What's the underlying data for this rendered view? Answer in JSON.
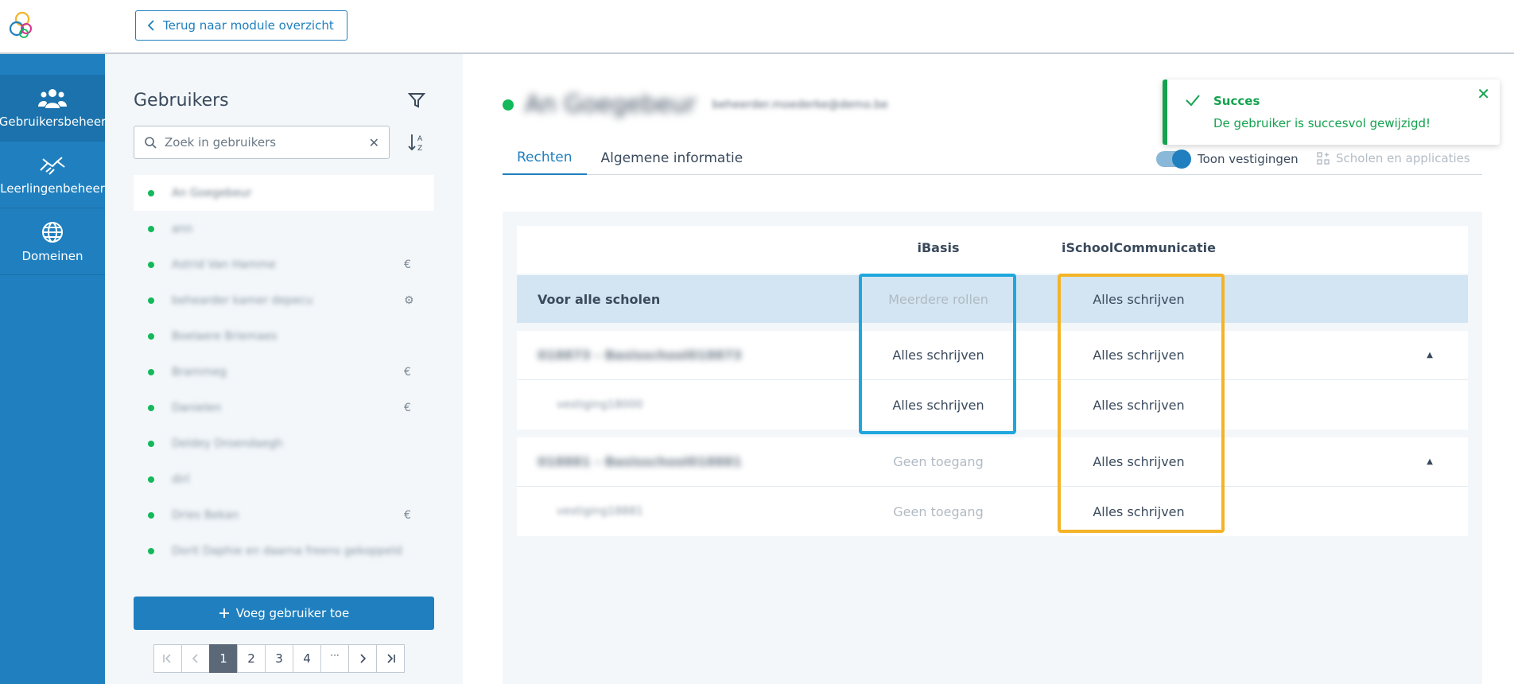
{
  "header": {
    "back_label": "Terug naar module overzicht"
  },
  "nav": [
    {
      "label": "Gebruikersbeheer",
      "icon": "users-icon"
    },
    {
      "label": "Leerlingenbeheer",
      "icon": "handshake-icon"
    },
    {
      "label": "Domeinen",
      "icon": "globe-icon"
    }
  ],
  "userpanel": {
    "title": "Gebruikers",
    "search_placeholder": "Zoek in gebruikers",
    "users": [
      {
        "name": "An Goegebeur",
        "icon": ""
      },
      {
        "name": "ann",
        "icon": ""
      },
      {
        "name": "Astrid Van Hamme",
        "icon": "€"
      },
      {
        "name": "behearder kamer depecu",
        "icon": "⚙"
      },
      {
        "name": "Boelaere Briemaes",
        "icon": ""
      },
      {
        "name": "Brammeg",
        "icon": "€"
      },
      {
        "name": "Danielen",
        "icon": "€"
      },
      {
        "name": "Deldey Droendaegh",
        "icon": ""
      },
      {
        "name": "dirl",
        "icon": ""
      },
      {
        "name": "Dries Bekan",
        "icon": "€"
      },
      {
        "name": "Dorit Daphie en daarna freens gekoppeld",
        "icon": ""
      }
    ],
    "add_label": "Voeg gebruiker toe",
    "pages": [
      "1",
      "2",
      "3",
      "4"
    ]
  },
  "main": {
    "user_name": "An Goegebeur",
    "user_email": "beheerder.moederke@demo.be",
    "tabs": [
      "Rechten",
      "Algemene informatie"
    ],
    "toggle_label": "Toon vestigingen",
    "apps_label": "Scholen en applicaties",
    "columns": [
      "iBasis",
      "iSchoolCommunicatie"
    ],
    "rows": {
      "all": {
        "label": "Voor alle scholen",
        "ibasis": "Meerdere rollen",
        "isc": "Alles schrijven"
      },
      "g1": {
        "label": "018873 - Basisschool018873",
        "ibasis": "Alles schrijven",
        "isc": "Alles schrijven"
      },
      "g1s": {
        "label": "vestiging18000",
        "ibasis": "Alles schrijven",
        "isc": "Alles schrijven"
      },
      "g2": {
        "label": "018881 - Basisschool018881",
        "ibasis": "Geen toegang",
        "isc": "Alles schrijven"
      },
      "g2s": {
        "label": "vestiging18881",
        "ibasis": "Geen toegang",
        "isc": "Alles schrijven"
      }
    }
  },
  "toast": {
    "title": "Succes",
    "message": "De gebruiker is succesvol gewijzigd!"
  },
  "colors": {
    "primary": "#2080bf",
    "success": "#14a24f",
    "highlight_blue": "#1fa7dd",
    "highlight_orange": "#f4b428"
  }
}
